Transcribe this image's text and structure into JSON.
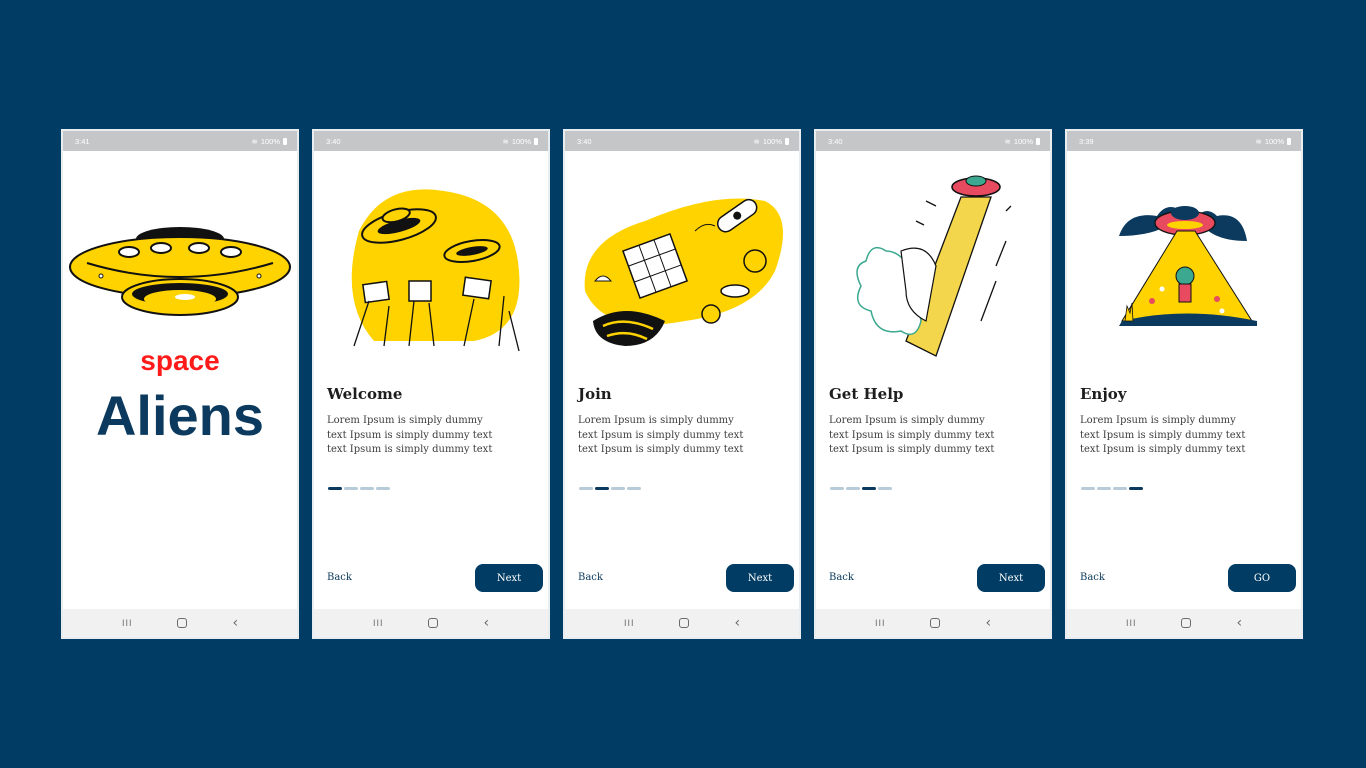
{
  "colors": {
    "background": "#003c63",
    "accent_yellow": "#ffd300",
    "dark_blue": "#0b3a5e",
    "red": "#ff1a1a",
    "dot_inactive": "#b7cbd8"
  },
  "status_icons": [
    "wifi-icon",
    "signal-icon",
    "battery-icon"
  ],
  "splash": {
    "time": "3:41",
    "battery": "100%",
    "space": "space",
    "aliens": "Aliens"
  },
  "screens": [
    {
      "time": "3:40",
      "battery": "100%",
      "title": "Welcome",
      "lines": [
        "Lorem Ipsum is simply dummy",
        "text Ipsum is simply dummy text",
        "text Ipsum is simply dummy text"
      ],
      "active_dot": 0,
      "back_label": "Back",
      "next_label": "Next"
    },
    {
      "time": "3:40",
      "battery": "100%",
      "title": "Join",
      "lines": [
        "Lorem Ipsum is simply dummy",
        "text Ipsum is simply dummy text",
        "text Ipsum is simply dummy text"
      ],
      "active_dot": 1,
      "back_label": "Back",
      "next_label": "Next"
    },
    {
      "time": "3:40",
      "battery": "100%",
      "title": "Get Help",
      "lines": [
        "Lorem Ipsum is simply dummy",
        "text Ipsum is simply dummy text",
        "text Ipsum is simply dummy text"
      ],
      "active_dot": 2,
      "back_label": "Back",
      "next_label": "Next"
    },
    {
      "time": "3:39",
      "battery": "100%",
      "title": "Enjoy",
      "lines": [
        "Lorem Ipsum is simply dummy",
        "text Ipsum is simply dummy text",
        "text Ipsum is simply dummy text"
      ],
      "active_dot": 3,
      "back_label": "Back",
      "next_label": "GO"
    }
  ],
  "nav": {
    "recent": "III",
    "back": "‹"
  }
}
